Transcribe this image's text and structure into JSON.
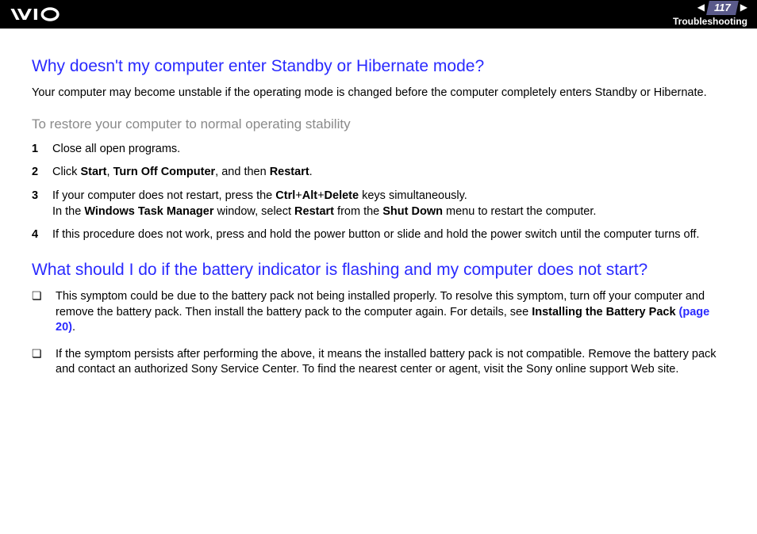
{
  "header": {
    "page": "117",
    "section": "Troubleshooting"
  },
  "h1": "Why doesn't my computer enter Standby or Hibernate mode?",
  "intro": "Your computer may become unstable if the operating mode is changed before the computer completely enters Standby or Hibernate.",
  "sub": "To restore your computer to normal operating stability",
  "s1": {
    "n": "1",
    "t": "Close all open programs."
  },
  "s2": {
    "n": "2",
    "a": "Click ",
    "b1": "Start",
    "c": ", ",
    "b2": "Turn Off Computer",
    "d": ", and then ",
    "b3": "Restart",
    "e": "."
  },
  "s3": {
    "n": "3",
    "a": "If your computer does not restart, press the ",
    "b1": "Ctrl",
    "p1": "+",
    "b2": "Alt",
    "p2": "+",
    "b3": "Delete",
    "c": " keys simultaneously.",
    "br": "In the ",
    "b4": "Windows Task Manager",
    "d": " window, select ",
    "b5": "Restart",
    "e": " from the ",
    "b6": "Shut Down",
    "f": " menu to restart the computer."
  },
  "s4": {
    "n": "4",
    "t": "If this procedure does not work, press and hold the power button or slide and hold the power switch until the computer turns off."
  },
  "h2": "What should I do if the battery indicator is flashing and my computer does not start?",
  "u1": {
    "a": "This symptom could be due to the battery pack not being installed properly. To resolve this symptom, turn off your computer and remove the battery pack. Then install the battery pack to the computer again. For details, see ",
    "b1": "Installing the Battery Pack ",
    "link": "(page 20)",
    "e": "."
  },
  "u2": {
    "t": "If the symptom persists after performing the above, it means the installed battery pack is not compatible. Remove the battery pack and contact an authorized Sony Service Center. To find the nearest center or agent, visit the Sony online support Web site."
  }
}
